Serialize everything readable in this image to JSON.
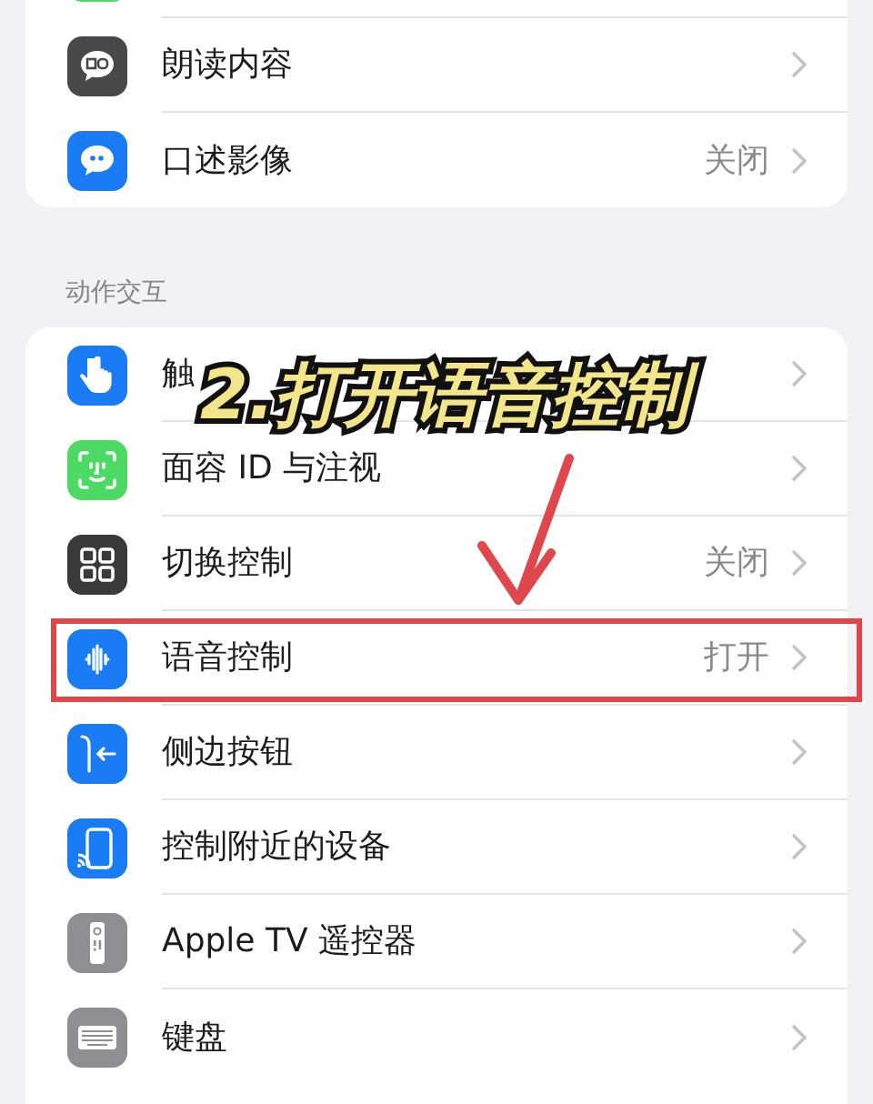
{
  "sections": [
    {
      "rows": [
        {
          "label": "",
          "value": "",
          "highlighted": false
        },
        {
          "label": "朗读内容",
          "value": "",
          "highlighted": false
        },
        {
          "label": "口述影像",
          "value": "关闭",
          "highlighted": false
        }
      ]
    },
    {
      "header": "动作交互",
      "rows": [
        {
          "label": "触",
          "value": "",
          "highlighted": false
        },
        {
          "label": "面容 ID 与注视",
          "value": "",
          "highlighted": false
        },
        {
          "label": "切换控制",
          "value": "关闭",
          "highlighted": false
        },
        {
          "label": "语音控制",
          "value": "打开",
          "highlighted": true
        },
        {
          "label": "侧边按钮",
          "value": "",
          "highlighted": false
        },
        {
          "label": "控制附近的设备",
          "value": "",
          "highlighted": false
        },
        {
          "label": "Apple TV 遥控器",
          "value": "",
          "highlighted": false
        },
        {
          "label": "键盘",
          "value": "",
          "highlighted": false
        }
      ]
    }
  ],
  "annotation": {
    "caption": "2.打开语音控制"
  }
}
